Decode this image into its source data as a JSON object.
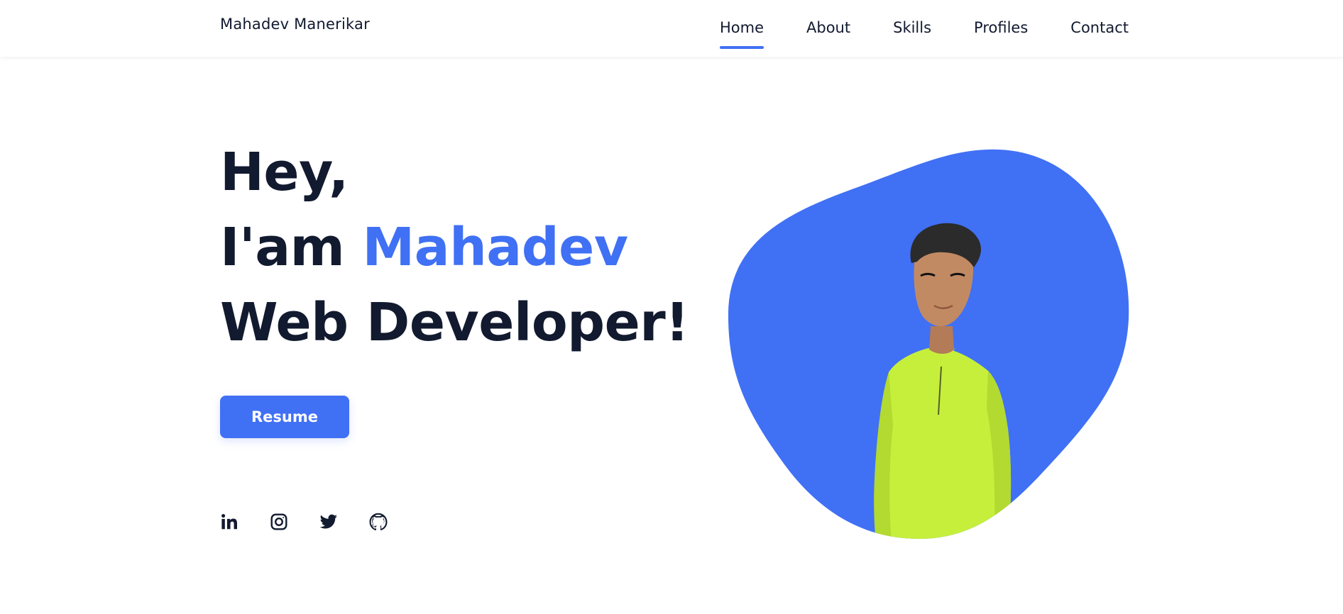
{
  "header": {
    "brand": "Mahadev Manerikar",
    "nav": [
      {
        "label": "Home",
        "active": true
      },
      {
        "label": "About",
        "active": false
      },
      {
        "label": "Skills",
        "active": false
      },
      {
        "label": "Profiles",
        "active": false
      },
      {
        "label": "Contact",
        "active": false
      }
    ]
  },
  "hero": {
    "line1": "Hey,",
    "line2_prefix": "I'am",
    "line2_highlight": "Mahadev",
    "line3": "Web Developer!",
    "resume_label": "Resume",
    "social_icons": [
      "linkedin-icon",
      "instagram-icon",
      "twitter-icon",
      "github-icon"
    ]
  },
  "colors": {
    "accent": "#4070f4",
    "text_dark": "#121a2f",
    "shirt": "#c6ef3b"
  }
}
